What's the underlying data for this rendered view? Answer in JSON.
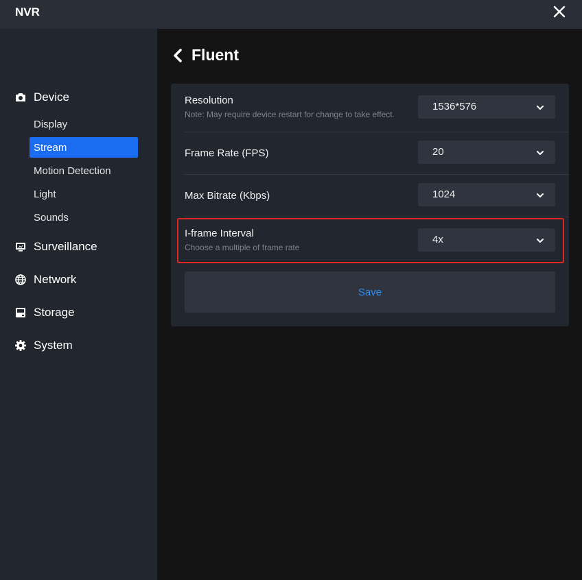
{
  "app": {
    "title": "NVR"
  },
  "sidebar": {
    "groups": [
      {
        "label": "Device",
        "icon": "camera-icon"
      },
      {
        "label": "Surveillance",
        "icon": "monitor-icon"
      },
      {
        "label": "Network",
        "icon": "globe-icon"
      },
      {
        "label": "Storage",
        "icon": "hard-drive-icon"
      },
      {
        "label": "System",
        "icon": "gear-icon"
      }
    ],
    "device_items": [
      {
        "label": "Display",
        "active": false
      },
      {
        "label": "Stream",
        "active": true
      },
      {
        "label": "Motion Detection",
        "active": false
      },
      {
        "label": "Light",
        "active": false
      },
      {
        "label": "Sounds",
        "active": false
      }
    ]
  },
  "page": {
    "title": "Fluent"
  },
  "settings": [
    {
      "label": "Resolution",
      "note": "Note: May require device restart for change to take effect.",
      "value": "1536*576"
    },
    {
      "label": "Frame Rate (FPS)",
      "note": "",
      "value": "20"
    },
    {
      "label": "Max Bitrate (Kbps)",
      "note": "",
      "value": "1024"
    },
    {
      "label": "I-frame Interval",
      "note": "Choose a multiple of frame rate",
      "value": "4x"
    }
  ],
  "actions": {
    "save_label": "Save"
  },
  "colors": {
    "accent": "#1a6cf0",
    "link": "#2f8ff5",
    "highlight": "#e0261d",
    "sidebar_bg": "#22262e",
    "main_bg": "#141414"
  }
}
